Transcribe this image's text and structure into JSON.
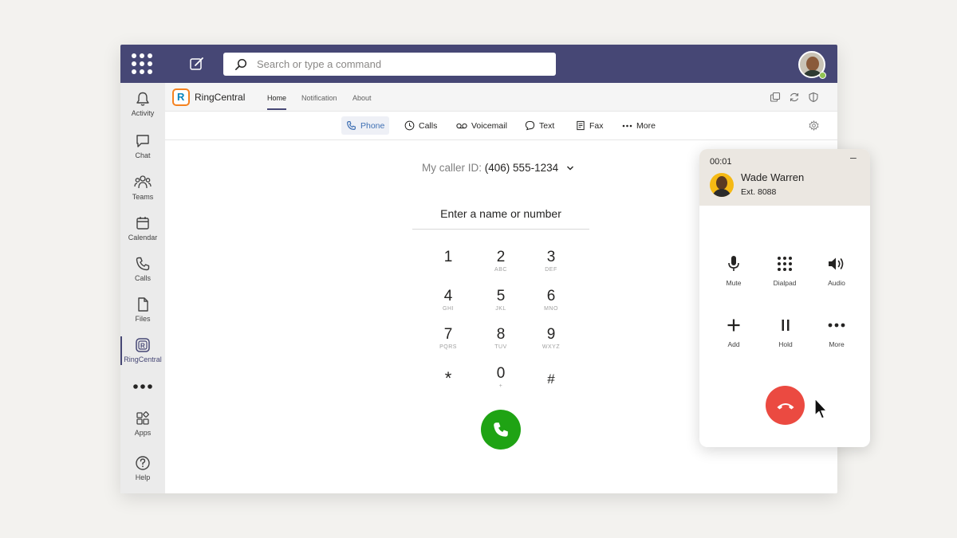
{
  "search": {
    "placeholder": "Search or type a command"
  },
  "rail": [
    {
      "label": "Activity",
      "icon": "bell-icon"
    },
    {
      "label": "Chat",
      "icon": "chat-icon"
    },
    {
      "label": "Teams",
      "icon": "teams-icon"
    },
    {
      "label": "Calendar",
      "icon": "calendar-icon"
    },
    {
      "label": "Calls",
      "icon": "phone-icon"
    },
    {
      "label": "Files",
      "icon": "file-icon"
    },
    {
      "label": "RingCentral",
      "icon": "ringcentral-icon",
      "active": true
    },
    {
      "label": "",
      "icon": "more-icon"
    },
    {
      "label": "Apps",
      "icon": "apps-icon"
    },
    {
      "label": "Help",
      "icon": "help-icon"
    }
  ],
  "app": {
    "name": "RingCentral",
    "logo_letter": "R",
    "tabs": [
      "Home",
      "Notification",
      "About"
    ],
    "active_tab": "Home"
  },
  "subnav": [
    {
      "label": "Phone",
      "icon": "phone-icon",
      "active": true
    },
    {
      "label": "Calls",
      "icon": "clock-icon"
    },
    {
      "label": "Voicemail",
      "icon": "voicemail-icon"
    },
    {
      "label": "Text",
      "icon": "text-bubble-icon"
    },
    {
      "label": "Fax",
      "icon": "fax-icon"
    },
    {
      "label": "More",
      "icon": "ellipsis-icon"
    }
  ],
  "dialer": {
    "caller_id_label": "My caller ID:",
    "caller_id_number": "(406) 555-1234",
    "input_placeholder": "Enter a name or number",
    "keys": [
      {
        "digit": "1",
        "sub": ""
      },
      {
        "digit": "2",
        "sub": "ABC"
      },
      {
        "digit": "3",
        "sub": "DEF"
      },
      {
        "digit": "4",
        "sub": "GHI"
      },
      {
        "digit": "5",
        "sub": "JKL"
      },
      {
        "digit": "6",
        "sub": "MNO"
      },
      {
        "digit": "7",
        "sub": "PQRS"
      },
      {
        "digit": "8",
        "sub": "TUV"
      },
      {
        "digit": "9",
        "sub": "WXYZ"
      },
      {
        "digit": "*",
        "sub": ""
      },
      {
        "digit": "0",
        "sub": "+"
      },
      {
        "digit": "#",
        "sub": ""
      }
    ]
  },
  "call_panel": {
    "timer": "00:01",
    "minimize": "–",
    "contact_name": "Wade Warren",
    "contact_ext": "Ext. 8088",
    "controls": [
      {
        "label": "Mute",
        "icon": "microphone-icon"
      },
      {
        "label": "Dialpad",
        "icon": "dialpad-icon"
      },
      {
        "label": "Audio",
        "icon": "speaker-icon"
      },
      {
        "label": "Add",
        "icon": "plus-icon"
      },
      {
        "label": "Hold",
        "icon": "pause-icon"
      },
      {
        "label": "More",
        "icon": "ellipsis-icon"
      }
    ]
  },
  "colors": {
    "teams_purple": "#464775",
    "call_green": "#1fa314",
    "hangup_red": "#eb4a41",
    "ringcentral_orange": "#f58220",
    "ringcentral_blue": "#0684bd"
  }
}
